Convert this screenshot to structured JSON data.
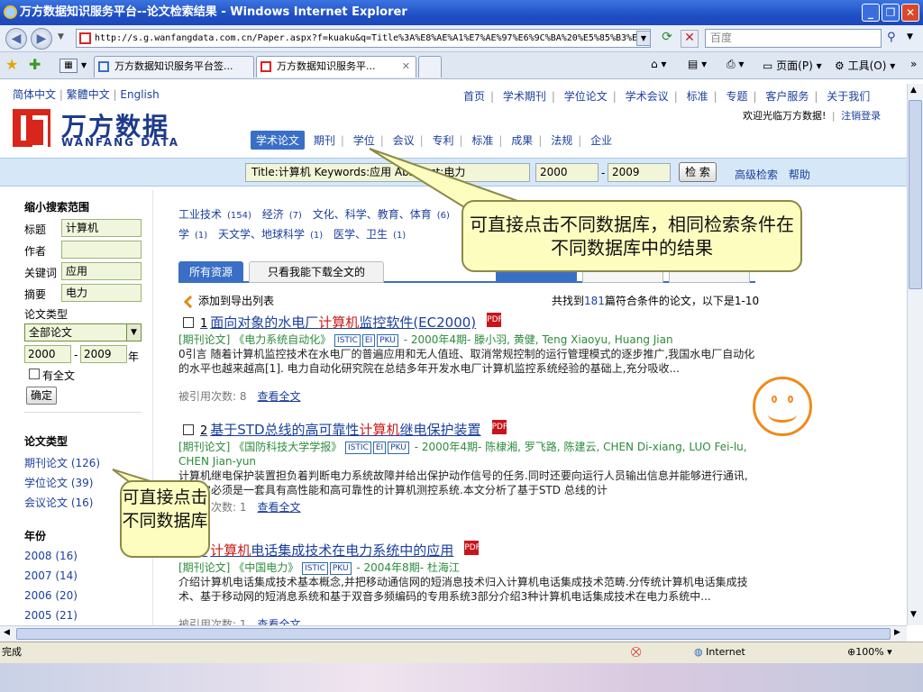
{
  "window": {
    "title": "万方数据知识服务平台--论文检索结果 - Windows Internet Explorer",
    "url": "http://s.g.wanfangdata.com.cn/Paper.aspx?f=kuaku&q=Title%3A%E8%AE%A1%E7%AE%97%E6%9C%BA%20%E5%85%B3%E",
    "search_placeholder": "百度",
    "tabs": [
      "万方数据知识服务平台签...",
      "万方数据知识服务平..."
    ],
    "cmd_page": "页面(P)",
    "cmd_tools": "工具(O)",
    "status_left": "完成",
    "status_zone": "Internet",
    "zoom": "100%"
  },
  "site": {
    "lang_links": [
      "简体中文",
      "繁體中文",
      "English"
    ],
    "top_nav": [
      "首页",
      "学术期刊",
      "学位论文",
      "学术会议",
      "标准",
      "专题",
      "客户服务",
      "关于我们"
    ],
    "welcome": "欢迎光临万方数据!",
    "logout": "注销登录",
    "logo_cn": "万方数据",
    "logo_en": "WANFANG DATA",
    "db_tabs": {
      "active": "学术论文",
      "items": [
        "期刊",
        "学位",
        "会议",
        "专利",
        "标准",
        "成果",
        "法规",
        "企业"
      ]
    },
    "search": {
      "query": "Title:计算机  Keywords:应用  Abstract:电力",
      "year_from": "2000",
      "year_to": "2009",
      "button": "检 索",
      "advanced": "高级检索",
      "help": "帮助"
    }
  },
  "sidebar": {
    "narrow_title": "缩小搜索范围",
    "fields": [
      {
        "label": "标题",
        "value": "计算机"
      },
      {
        "label": "作者",
        "value": ""
      },
      {
        "label": "关键词",
        "value": "应用"
      },
      {
        "label": "摘要",
        "value": "电力"
      }
    ],
    "type_label": "论文类型",
    "type_value": "全部论文",
    "year_from": "2000",
    "year_to": "2009",
    "year_unit": "年",
    "fulltext_label": "有全文",
    "confirm": "确定",
    "types_title": "论文类型",
    "types": [
      "期刊论文 (126)",
      "学位论文 (39)",
      "会议论文 (16)"
    ],
    "years_title": "年份",
    "years": [
      "2008 (16)",
      "2007 (14)",
      "2006 (20)",
      "2005 (21)"
    ]
  },
  "main": {
    "categories_row1": [
      {
        "name": "工业技术",
        "count": "(154)"
      },
      {
        "name": "经济",
        "count": "(7)"
      },
      {
        "name": "文化、科学、教育、体育",
        "count": "(6)"
      }
    ],
    "categories_row2": [
      {
        "name": "学",
        "count": "(1)"
      },
      {
        "name": "天文学、地球科学",
        "count": "(1)"
      },
      {
        "name": "医学、卫生",
        "count": "(1)"
      }
    ],
    "tab_all": "所有资源",
    "tab_fulltext": "只看我能下载全文的",
    "export": "添加到导出列表",
    "found_prefix": "共找到",
    "found_count": "181",
    "found_suffix": "篇符合条件的论文，以下是1-10",
    "records": [
      {
        "num": "1",
        "title_pre": "面向对象的水电厂",
        "title_hl": "计算机",
        "title_post": "监控软件(EC2000)",
        "type": "[期刊论文]",
        "journal": "《电力系统自动化》",
        "tags": [
          "ISTIC",
          "EI",
          "PKU"
        ],
        "info": "- 2000年4期- 滕小羽, 黄健, Teng Xiaoyu, Huang Jian",
        "abstract": "0引言 随着计算机监控技术在水电厂的普遍应用和无人值班、取消常规控制的运行管理模式的逐步推广,我国水电厂自动化的水平也越来越高[1]. 电力自动化研究院在总结多年开发水电厂计算机监控系统经验的基础上,充分吸收...",
        "cite_label": "被引用次数: 8",
        "fulltext": "查看全文"
      },
      {
        "num": "2",
        "title_pre": "基于STD总线的高可靠性",
        "title_hl": "计算机",
        "title_post": "继电保护装置",
        "type": "[期刊论文]",
        "journal": "《国防科技大学学报》",
        "tags": [
          "ISTIC",
          "EI",
          "PKU"
        ],
        "info": "- 2000年4期- 陈棣湘, 罗飞路, 陈建云, CHEN Di-xiang, LUO Fei-lu, CHEN Jian-yun",
        "abstract": "计算机继电保护装置担负着判断电力系统故障并给出保护动作信号的任务.同时还要向运行人员输出信息并能够进行通讯,所以它必须是一套具有高性能和高可靠性的计算机测控系统.本文分析了基于STD 总线的计",
        "cite_label": "被引用次数: 1",
        "fulltext": "查看全文"
      },
      {
        "num": "3",
        "title_pre": "",
        "title_hl": "计算机",
        "title_post": "电话集成技术在电力系统中的应用",
        "type": "[期刊论文]",
        "journal": "《中国电力》",
        "tags": [
          "ISTIC",
          "PKU"
        ],
        "info": "- 2004年8期- 杜海江",
        "abstract": "介绍计算机电话集成技术基本概念,并把移动通信网的短消息技术归入计算机电话集成技术范畴.分传统计算机电话集成技术、基于移动网的短消息系统和基于双音多频编码的专用系统3部分介绍3种计算机电话集成技术在电力系统中...",
        "cite_label": "被引用次数: 1",
        "fulltext": "查看全文"
      }
    ]
  },
  "annotations": {
    "callout_top": "可直接点击不同数据库，相同检索条件在不同数据库中的结果",
    "callout_side": "可直接点击不同数据库"
  },
  "colors": {
    "brand_blue": "#1d3a8c",
    "brand_red": "#d9261c",
    "highlight_red": "#cc1a1a",
    "meta_green": "#2c8c3a",
    "callout_bg": "#fdfdc0"
  }
}
